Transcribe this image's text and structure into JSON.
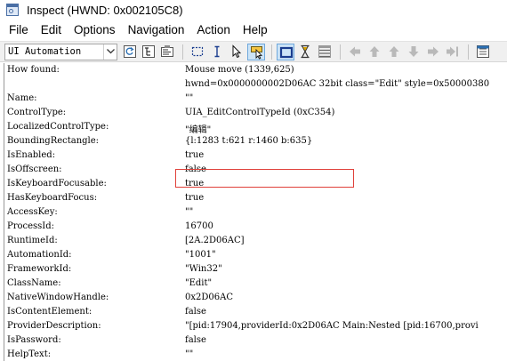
{
  "window": {
    "title": "Inspect  (HWND: 0x002105C8)"
  },
  "menu": [
    "File",
    "Edit",
    "Options",
    "Navigation",
    "Action",
    "Help"
  ],
  "toolbar": {
    "mode_select": "UI Automation"
  },
  "properties": [
    {
      "key": "How found:",
      "value": "Mouse move (1339,625)"
    },
    {
      "key": "",
      "value": "hwnd=0x0000000002D06AC 32bit class=\"Edit\" style=0x50000380"
    },
    {
      "key": "Name:",
      "value": "\"\""
    },
    {
      "key": "ControlType:",
      "value": "UIA_EditControlTypeId (0xC354)"
    },
    {
      "key": "LocalizedControlType:",
      "value": "\"编辑\""
    },
    {
      "key": "BoundingRectangle:",
      "value": "{l:1283 t:621 r:1460 b:635}"
    },
    {
      "key": "IsEnabled:",
      "value": "true"
    },
    {
      "key": "IsOffscreen:",
      "value": "false"
    },
    {
      "key": "IsKeyboardFocusable:",
      "value": "true"
    },
    {
      "key": "HasKeyboardFocus:",
      "value": "true"
    },
    {
      "key": "AccessKey:",
      "value": "\"\""
    },
    {
      "key": "ProcessId:",
      "value": "16700"
    },
    {
      "key": "RuntimeId:",
      "value": "[2A.2D06AC]"
    },
    {
      "key": "AutomationId:",
      "value": "\"1001\""
    },
    {
      "key": "FrameworkId:",
      "value": "\"Win32\""
    },
    {
      "key": "ClassName:",
      "value": "\"Edit\""
    },
    {
      "key": "NativeWindowHandle:",
      "value": "0x2D06AC"
    },
    {
      "key": "IsContentElement:",
      "value": "false"
    },
    {
      "key": "ProviderDescription:",
      "value": "\"[pid:17904,providerId:0x2D06AC Main:Nested [pid:16700,provi"
    },
    {
      "key": "IsPassword:",
      "value": "false"
    },
    {
      "key": "HelpText:",
      "value": "\"\""
    }
  ],
  "highlighted_property": "ControlType:",
  "colors": {
    "highlight_border": "#e0413a",
    "toolbar_bg": "#f0f0f0",
    "pressed_button": "#cce4f7"
  },
  "icons": {
    "app": "inspect-window-icon",
    "toolbar": [
      "refresh-icon",
      "tree-view-icon",
      "properties-icon",
      "focus-rect-icon",
      "text-cursor-icon",
      "pointer-icon",
      "hover-tracking-icon",
      "highlight-icon",
      "timer-icon",
      "events-icon",
      "nav-left-icon",
      "nav-up-icon",
      "nav-up-alt-icon",
      "nav-down-icon",
      "nav-right-icon",
      "nav-end-icon",
      "expand-icon"
    ]
  }
}
